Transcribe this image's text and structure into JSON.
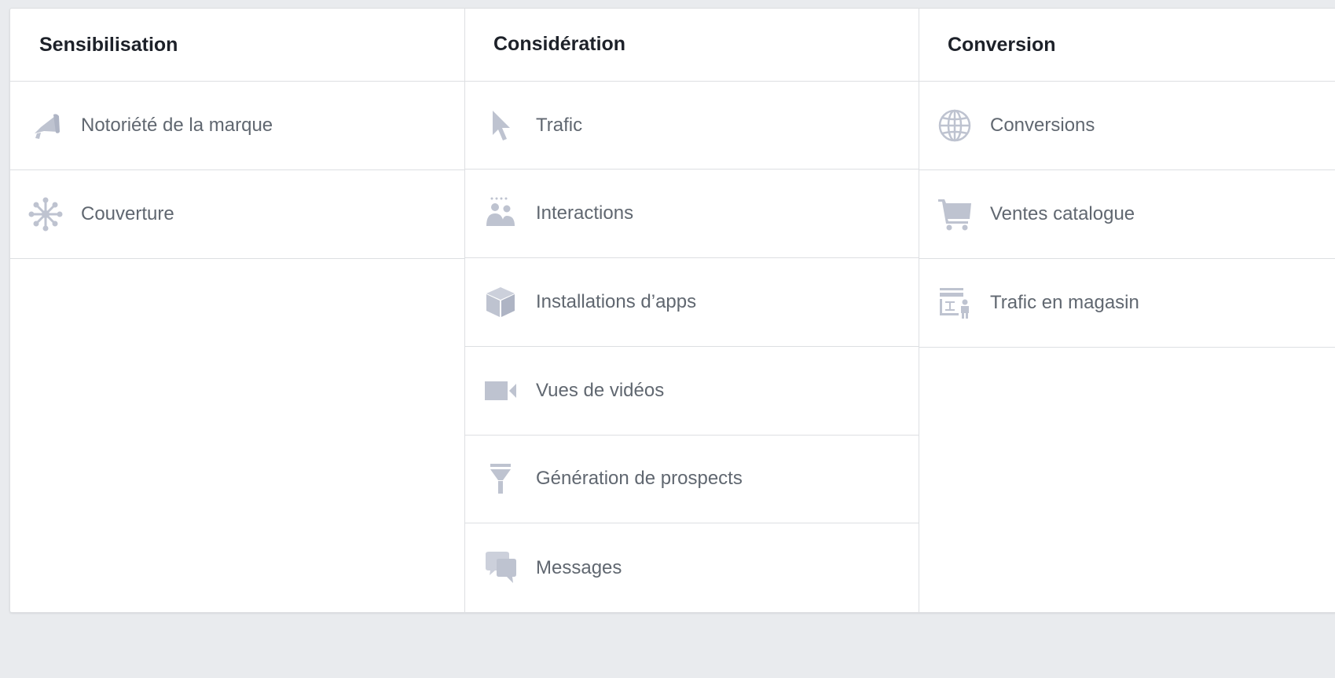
{
  "colors": {
    "icon": "#bec3d0",
    "label": "#606770",
    "header": "#1d2129",
    "border": "#dddfe2",
    "background": "#e9ebee"
  },
  "columns": [
    {
      "header": "Sensibilisation",
      "items": [
        {
          "label": "Notoriété de la marque",
          "icon": "megaphone-icon"
        },
        {
          "label": "Couverture",
          "icon": "network-icon"
        }
      ]
    },
    {
      "header": "Considération",
      "items": [
        {
          "label": "Trafic",
          "icon": "cursor-icon"
        },
        {
          "label": "Interactions",
          "icon": "people-icon"
        },
        {
          "label": "Installations d’apps",
          "icon": "box-icon"
        },
        {
          "label": "Vues de vidéos",
          "icon": "video-camera-icon"
        },
        {
          "label": "Génération de prospects",
          "icon": "funnel-icon"
        },
        {
          "label": "Messages",
          "icon": "chat-bubbles-icon"
        }
      ]
    },
    {
      "header": "Conversion",
      "items": [
        {
          "label": "Conversions",
          "icon": "globe-icon"
        },
        {
          "label": "Ventes catalogue",
          "icon": "shopping-cart-icon"
        },
        {
          "label": "Trafic en magasin",
          "icon": "store-person-icon"
        }
      ]
    }
  ]
}
